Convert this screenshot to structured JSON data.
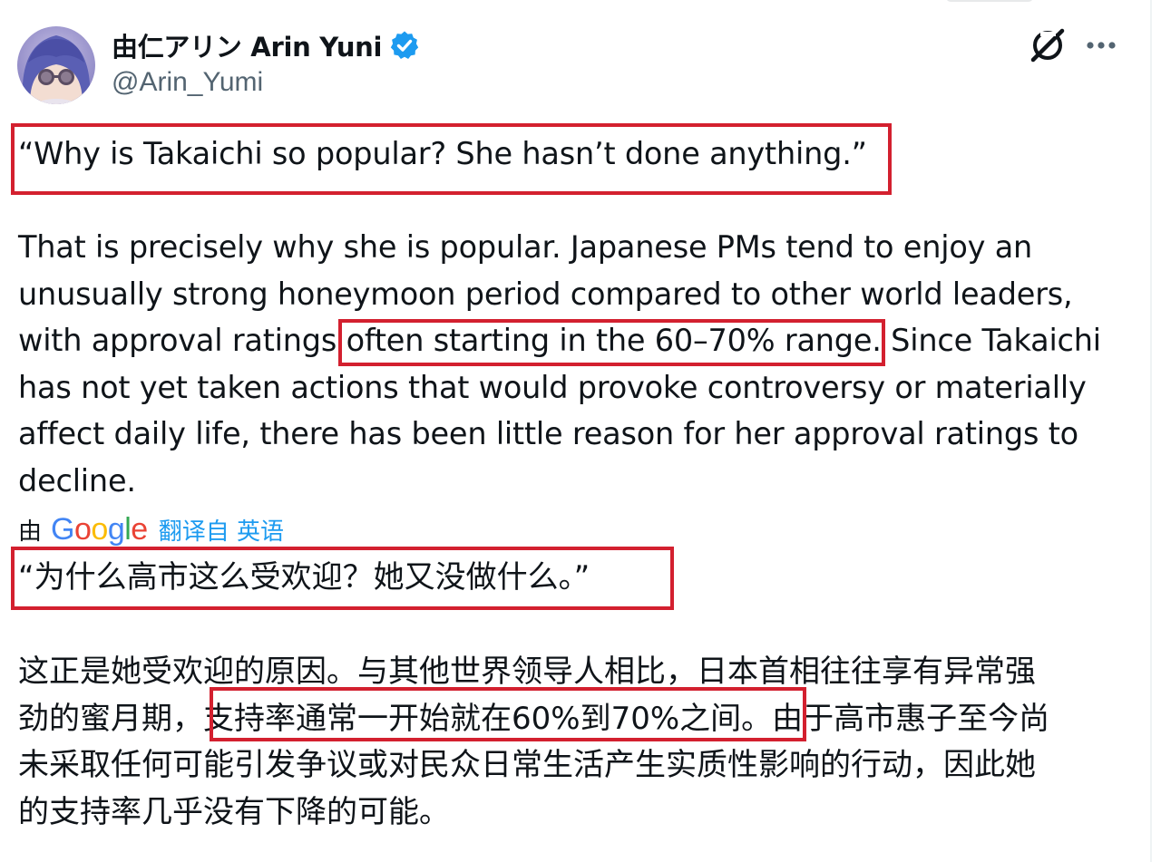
{
  "author": {
    "display_name": "由仁アリン Arin Yuni",
    "handle": "@Arin_Yumi",
    "verified": true,
    "badge_color": "#1d9bf0"
  },
  "header_icons": [
    "grok-icon",
    "more-options-icon"
  ],
  "post_en": {
    "quote": "“Why is Takaichi so popular? She hasn’t done anything.”",
    "body_lines": [
      "That is precisely why she is popular. Japanese PMs tend to enjoy an",
      "unusually strong honeymoon period compared to other world leaders,",
      "with approval ratings often starting in the 60–70% range. Since Takaichi",
      "has not yet taken actions that would provoke controversy or materially",
      "affect daily life, there has been little reason for her approval ratings to",
      "decline."
    ]
  },
  "translation": {
    "by_label": "由",
    "provider": "Google",
    "link_label": "翻译自 英语"
  },
  "post_zh": {
    "quote": "“为什么高市这么受欢迎？她又没做什么。”",
    "body_lines": [
      "这正是她受欢迎的原因。与其他世界领导人相比，日本首相往往享有异常强",
      "劲的蜜月期，支持率通常一开始就在60%到70%之间。由于高市惠子至今尚",
      "未采取任何可能引发争议或对民众日常生活产生实质性影响的行动，因此她",
      "的支持率几乎没有下降的可能。"
    ]
  },
  "annotation_color": "#d3202f"
}
